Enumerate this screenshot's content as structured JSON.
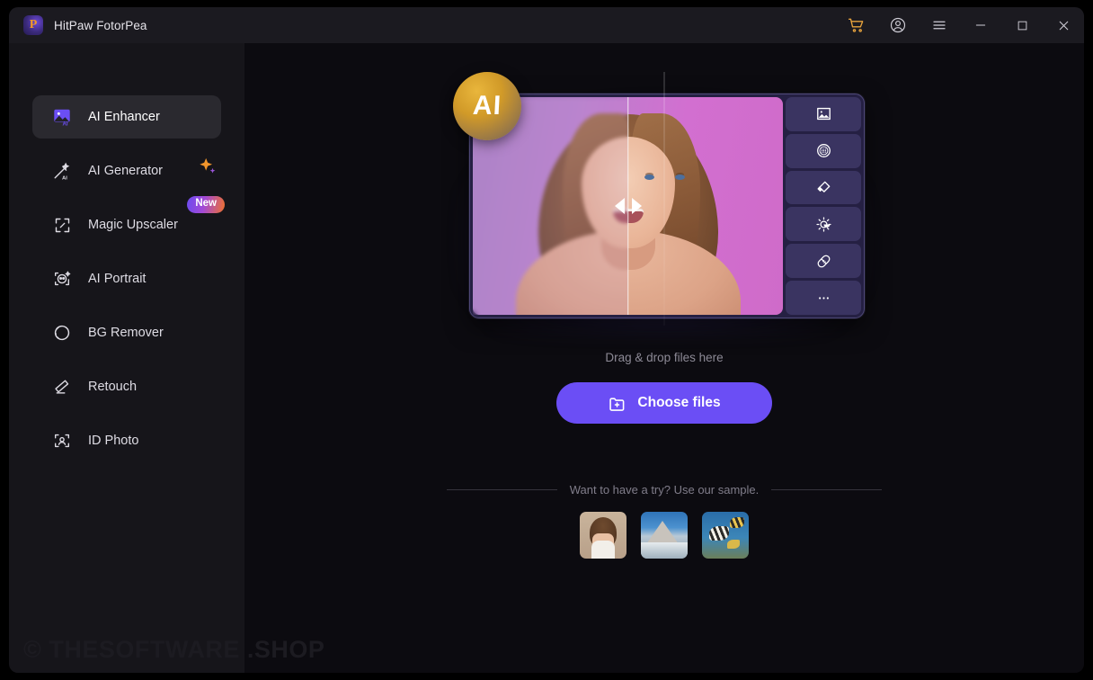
{
  "window": {
    "app_title": "HitPaw FotorPea",
    "logo_icon": "hitpaw-logo-icon",
    "controls": [
      {
        "name": "cart-icon",
        "label": "Cart"
      },
      {
        "name": "account-icon",
        "label": "Account"
      },
      {
        "name": "menu-icon",
        "label": "Menu"
      },
      {
        "name": "minimize-icon",
        "label": "Minimize"
      },
      {
        "name": "maximize-icon",
        "label": "Maximize"
      },
      {
        "name": "close-icon",
        "label": "Close"
      }
    ],
    "accent_color": "#6b4ef5",
    "cart_color": "#e8a33d",
    "titlebar_bg": "#1b1a20",
    "sidebar_bg": "#16151a",
    "main_bg": "#0c0b10"
  },
  "sidebar": {
    "items": [
      {
        "label": "AI Enhancer",
        "icon": "ai-enhancer-icon",
        "active": true,
        "badge": null
      },
      {
        "label": "AI Generator",
        "icon": "ai-generator-icon",
        "active": false,
        "badge": "sparkle"
      },
      {
        "label": "Magic Upscaler",
        "icon": "magic-upscaler-icon",
        "active": false,
        "badge": "New"
      },
      {
        "label": "AI Portrait",
        "icon": "ai-portrait-icon",
        "active": false,
        "badge": null
      },
      {
        "label": "BG Remover",
        "icon": "bg-remover-icon",
        "active": false,
        "badge": null
      },
      {
        "label": "Retouch",
        "icon": "retouch-icon",
        "active": false,
        "badge": null
      },
      {
        "label": "ID Photo",
        "icon": "id-photo-icon",
        "active": false,
        "badge": null
      }
    ]
  },
  "hero": {
    "ai_badge_text": "AI",
    "tools": [
      {
        "name": "photo-enhance-icon",
        "label": "Photo Enhance"
      },
      {
        "name": "denoise-icon",
        "label": "Denoise"
      },
      {
        "name": "colorize-icon",
        "label": "Colorize"
      },
      {
        "name": "brightness-icon",
        "label": "Brightness"
      },
      {
        "name": "scratch-repair-icon",
        "label": "Scratch Repair"
      },
      {
        "name": "more-icon",
        "label": "More"
      }
    ],
    "slider_position_percent": 50
  },
  "dropzone": {
    "hint": "Drag & drop files here",
    "button_label": "Choose files",
    "button_icon": "folder-add-icon",
    "button_color": "#6b4ef5"
  },
  "samples": {
    "heading": "Want to have a try? Use our sample.",
    "thumbs": [
      {
        "name": "sample-thumb-portrait",
        "alt": "Portrait of a woman"
      },
      {
        "name": "sample-thumb-mountain",
        "alt": "Snowy mountain village"
      },
      {
        "name": "sample-thumb-fish",
        "alt": "Tropical fish"
      }
    ]
  },
  "watermark": {
    "text": "© THESOFTWARE .SHOP"
  }
}
